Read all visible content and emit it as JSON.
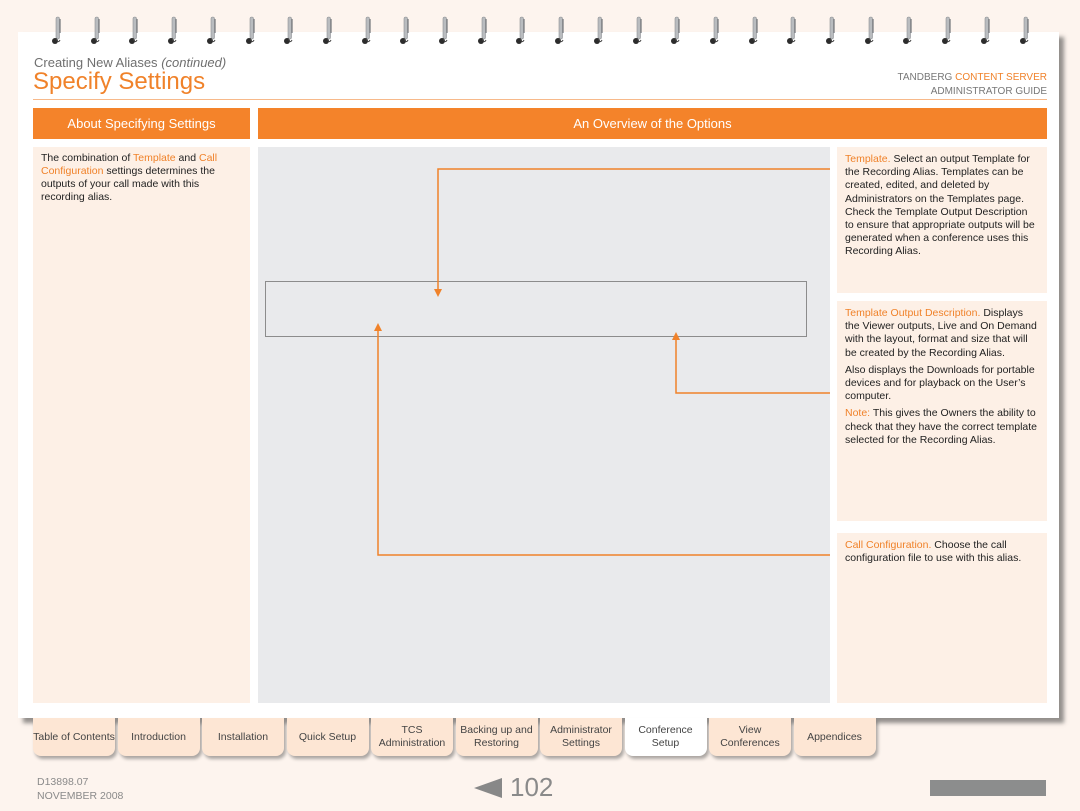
{
  "header": {
    "subtitle": "Creating New Aliases",
    "subtitle_suffix": "(continued)",
    "title": "Specify Settings",
    "brand_prefix": "TANDBERG",
    "brand_highlight": "CONTENT SERVER",
    "brand_line2": "ADMINISTRATOR GUIDE"
  },
  "sections": {
    "left_header": "About Specifying Settings",
    "right_header": "An Overview of the Options"
  },
  "left_panel": {
    "text_1": "The combination of ",
    "link_1": "Template",
    "text_2": " and ",
    "link_2": "Call Configuration",
    "text_3": " settings determines the outputs of your call made with this recording alias."
  },
  "notes": {
    "template": {
      "term": "Template.",
      "text": " Select an output Template for the Recording Alias. Templates can be created, edited, and deleted by Administrators on the Templates page. Check the Template Output Description to ensure that appropriate outputs will be generated when a conference uses this Recording Alias."
    },
    "output_description": {
      "term": "Template Output Description.",
      "text": " Displays the Viewer outputs, Live and On Demand with the layout, format and size that will be created by the Recording Alias.",
      "para2": "Also displays the Downloads for portable devices and for playback on the User’s computer.",
      "note_label": "Note:",
      "note_text": " This gives the Owners the ability to check that they have the correct template selected for the Recording Alias."
    },
    "call_configuration": {
      "term": "Call Configuration.",
      "text": " Choose the call configuration file to use with this alias."
    }
  },
  "tabs": [
    {
      "label": "Table of Contents",
      "active": false
    },
    {
      "label": "Introduction",
      "active": false
    },
    {
      "label": "Installation",
      "active": false
    },
    {
      "label": "Quick Setup",
      "active": false
    },
    {
      "label": "TCS Administration",
      "active": false
    },
    {
      "label": "Backing up and Restoring",
      "active": false
    },
    {
      "label": "Administrator Settings",
      "active": false
    },
    {
      "label": "Conference Setup",
      "active": true
    },
    {
      "label": "View Conferences",
      "active": false
    },
    {
      "label": "Appendices",
      "active": false
    }
  ],
  "footer": {
    "doc_number": "D13898.07",
    "date": "NOVEMBER 2008",
    "page_number": "102",
    "prev_icon": "left-triangle-icon"
  },
  "colors": {
    "accent": "#f4832a",
    "panel_bg": "#fdf0e6",
    "screenshot_bg": "#e9eaec",
    "background": "#fdf4ee"
  }
}
